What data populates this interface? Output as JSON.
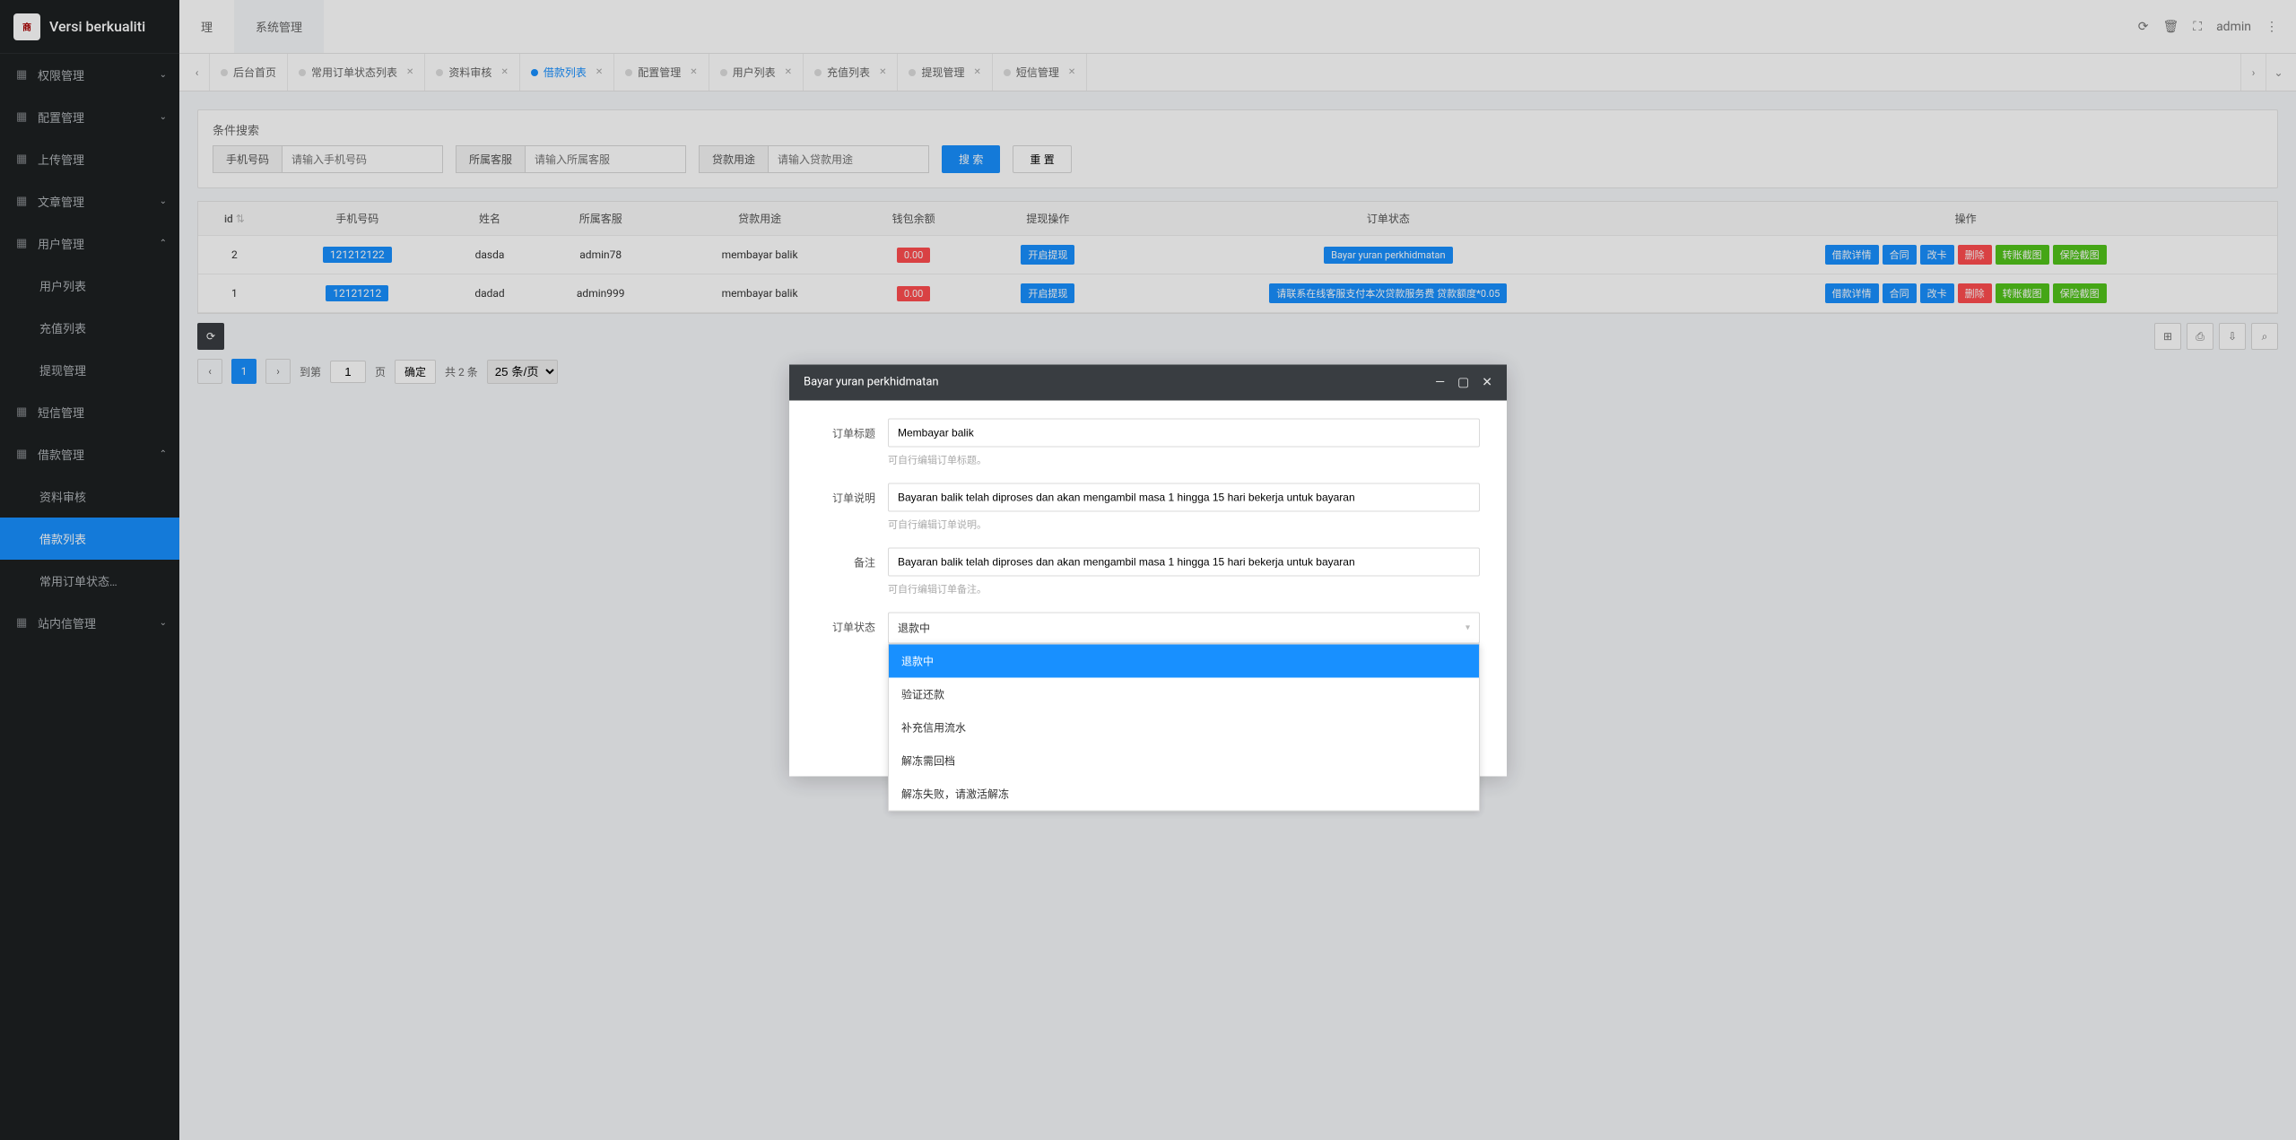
{
  "logo": {
    "text": "Versi berkualiti"
  },
  "sidebar": {
    "items": [
      {
        "label": "权限管理",
        "icon": "laptop",
        "expand": true
      },
      {
        "label": "配置管理",
        "icon": "gear",
        "expand": true
      },
      {
        "label": "上传管理",
        "icon": "upload",
        "expand": false
      },
      {
        "label": "文章管理",
        "icon": "book",
        "expand": true
      },
      {
        "label": "用户管理",
        "icon": "user",
        "expand": true,
        "open": true,
        "children": [
          {
            "label": "用户列表"
          },
          {
            "label": "充值列表"
          },
          {
            "label": "提现管理"
          }
        ]
      },
      {
        "label": "短信管理",
        "icon": "phone",
        "expand": false
      },
      {
        "label": "借款管理",
        "icon": "money",
        "expand": true,
        "open": true,
        "children": [
          {
            "label": "资料审核"
          },
          {
            "label": "借款列表",
            "active": true
          },
          {
            "label": "常用订单状态…"
          }
        ]
      },
      {
        "label": "站内信管理",
        "icon": "mail",
        "expand": true
      }
    ]
  },
  "topbar": {
    "tabs": [
      {
        "label": "理"
      },
      {
        "label": "系统管理",
        "active": true
      }
    ],
    "user": "admin",
    "icons": {
      "refresh": "⟳",
      "trash": "🗑",
      "fullscreen": "⛶",
      "more": "⋮"
    }
  },
  "tabstrip": {
    "left": "‹",
    "right": "›",
    "down": "⌄",
    "tabs": [
      {
        "label": "后台首页",
        "closable": false
      },
      {
        "label": "常用订单状态列表"
      },
      {
        "label": "资料审核"
      },
      {
        "label": "借款列表",
        "active": true
      },
      {
        "label": "配置管理"
      },
      {
        "label": "用户列表"
      },
      {
        "label": "充值列表"
      },
      {
        "label": "提现管理"
      },
      {
        "label": "短信管理"
      }
    ]
  },
  "search": {
    "title": "条件搜索",
    "fields": [
      {
        "label": "手机号码",
        "placeholder": "请输入手机号码"
      },
      {
        "label": "所属客服",
        "placeholder": "请输入所属客服"
      },
      {
        "label": "贷款用途",
        "placeholder": "请输入贷款用途"
      }
    ],
    "btn_search": "搜 索",
    "btn_reset": "重 置"
  },
  "table": {
    "headers": [
      "id",
      "手机号码",
      "姓名",
      "所属客服",
      "贷款用途",
      "钱包余额",
      "提现操作",
      "订单状态",
      "操作"
    ],
    "rows": [
      {
        "id": "2",
        "phone": "121212122",
        "name": "dasda",
        "cs": "admin78",
        "purpose": "membayar balik",
        "balance": "0.00",
        "op": "开启提现",
        "status": "Bayar yuran perkhidmatan"
      },
      {
        "id": "1",
        "phone": "12121212",
        "name": "dadad",
        "cs": "admin999",
        "purpose": "membayar balik",
        "balance": "0.00",
        "op": "开启提现",
        "status": "请联系在线客服支付本次贷款服务费 贷款额度*0.05"
      }
    ],
    "row_actions": [
      "借款详情",
      "合同",
      "改卡",
      "删除",
      "转账截图",
      "保险截图"
    ]
  },
  "pager": {
    "page": "1",
    "jump_label": "到第",
    "jump_value": "1",
    "page_unit": "页",
    "confirm": "确定",
    "total": "共 2 条",
    "perpage": "25 条/页"
  },
  "toolbar_right": {
    "cols": "⊞",
    "print": "⎙",
    "export": "⇩",
    "search": "⌕"
  },
  "modal": {
    "title": "Bayar yuran perkhidmatan",
    "form": {
      "f1": {
        "label": "订单标题",
        "value": "Membayar balik",
        "hint": "可自行编辑订单标题。"
      },
      "f2": {
        "label": "订单说明",
        "value": "Bayaran balik telah diproses dan akan mengambil masa 1 hingga 15 hari bekerja untuk bayaran",
        "hint": "可自行编辑订单说明。"
      },
      "f3": {
        "label": "备注",
        "value": "Bayaran balik telah diproses dan akan mengambil masa 1 hingga 15 hari bekerja untuk bayaran",
        "hint": "可自行编辑订单备注。"
      },
      "f4": {
        "label": "订单状态",
        "value": "退款中"
      }
    },
    "options": [
      "退款中",
      "验证还款",
      "补充信用流水",
      "解冻需回档",
      "解冻失败，请激活解冻"
    ]
  }
}
